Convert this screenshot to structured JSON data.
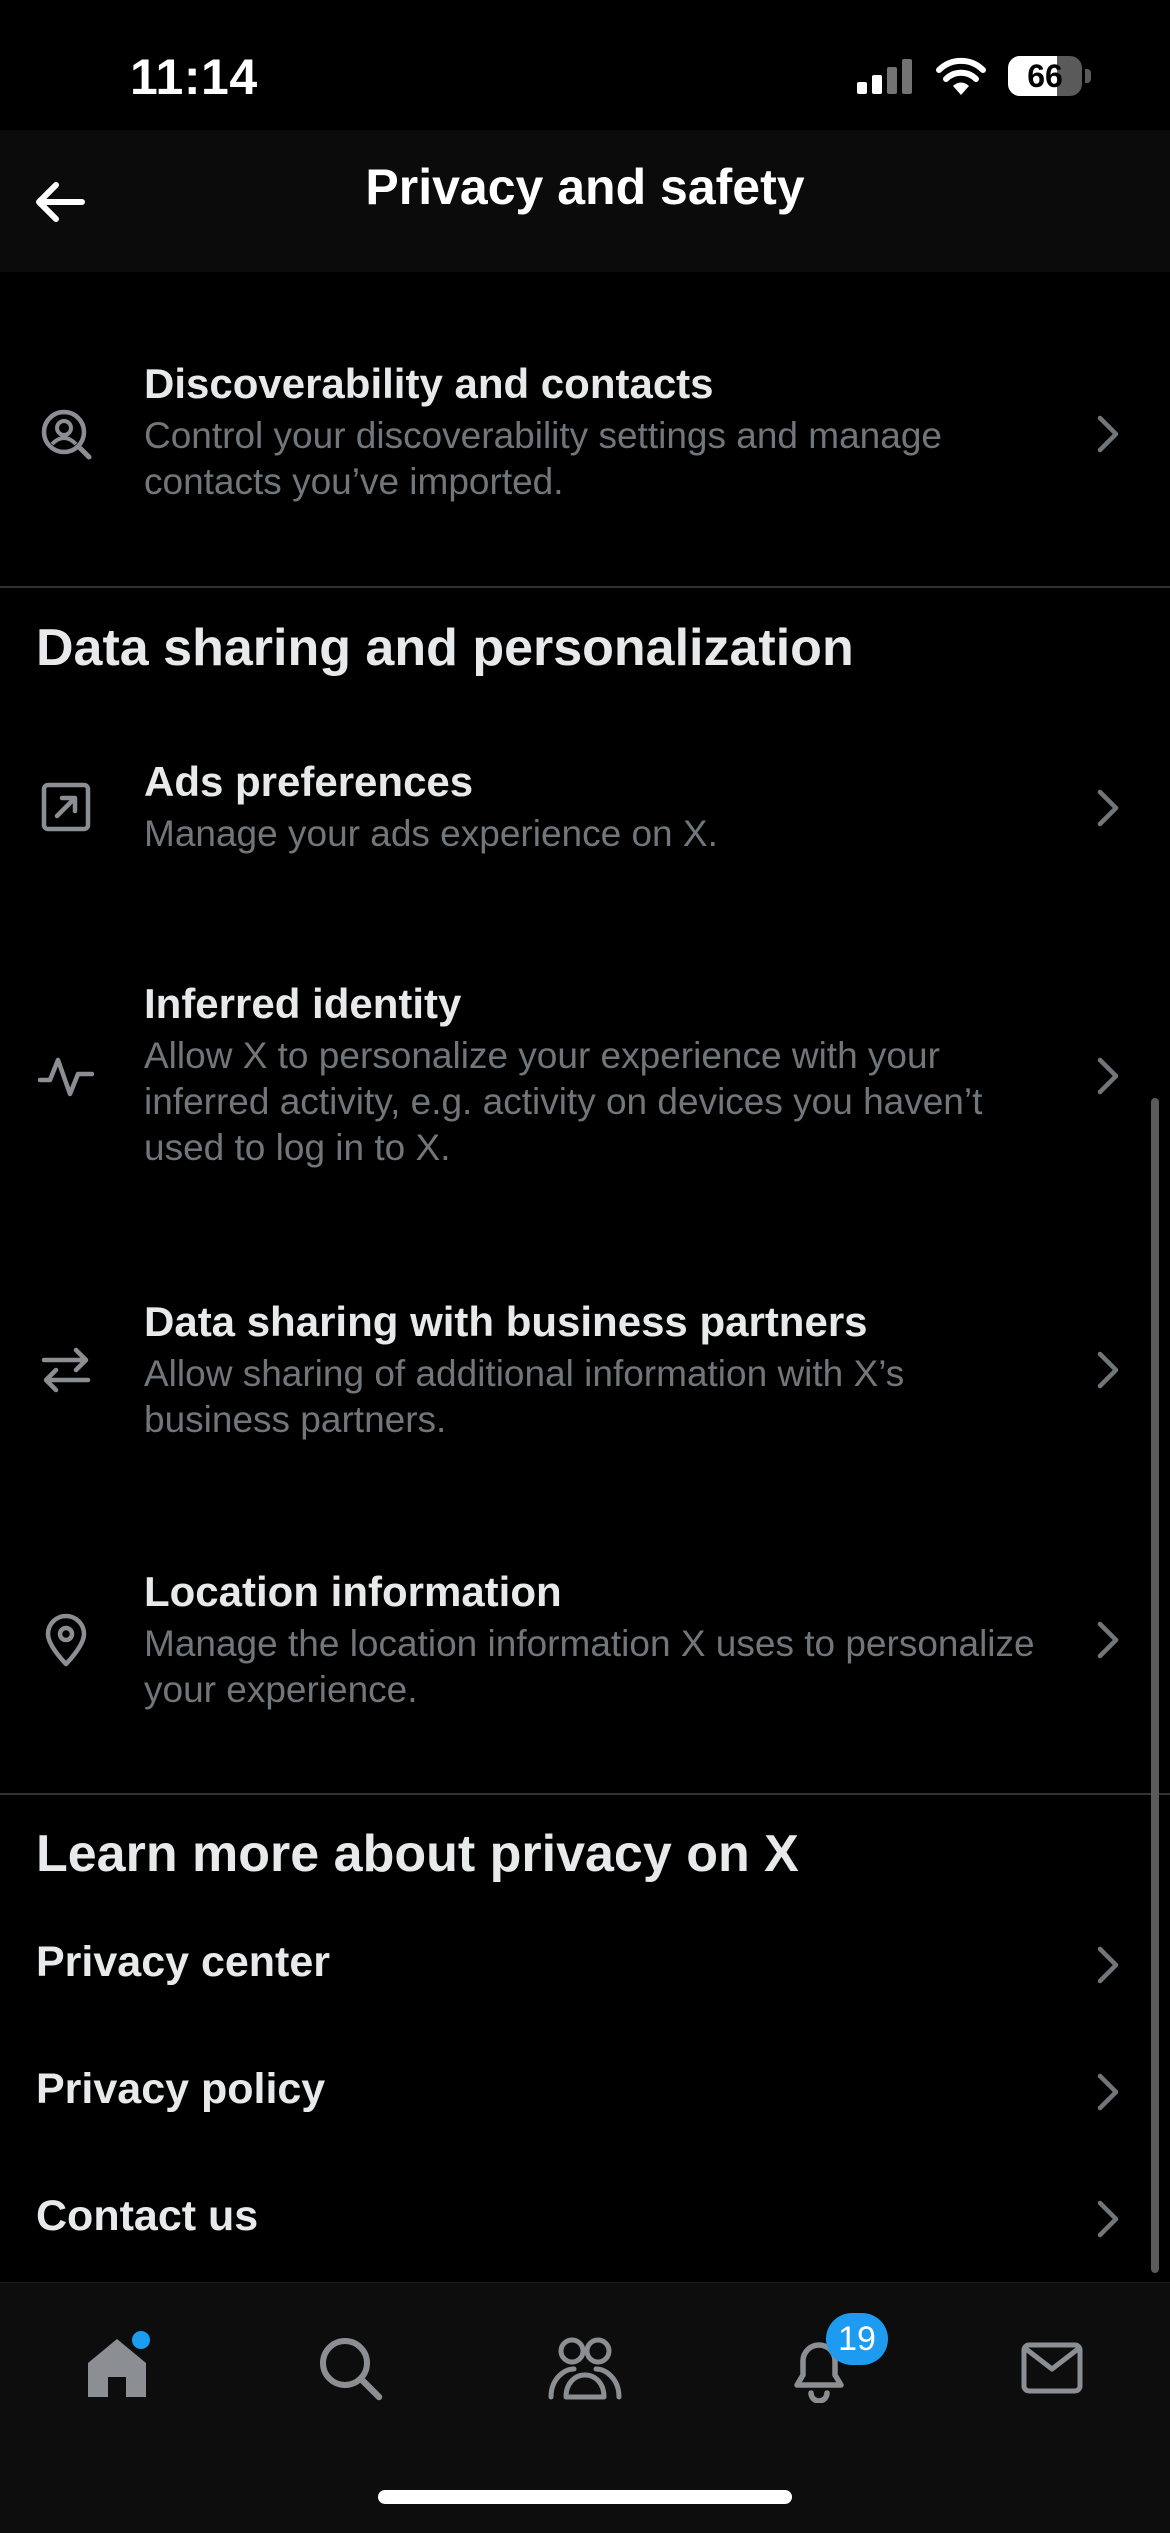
{
  "status_bar": {
    "time": "11:14",
    "battery_level": "66",
    "battery_fraction": 0.66
  },
  "header": {
    "title": "Privacy and safety",
    "back_icon": "arrow-left-icon"
  },
  "rows": {
    "discoverability": {
      "title": "Discoverability and contacts",
      "desc": "Control your discoverability settings and manage contacts you’ve imported.",
      "icon": "person-search-icon"
    },
    "ads": {
      "title": "Ads preferences",
      "desc": "Manage your ads experience on X.",
      "icon": "ad-box-icon"
    },
    "inferred": {
      "title": "Inferred identity",
      "desc": "Allow X to personalize your experience with your inferred activity, e.g. activity on devices you haven’t used to log in to X.",
      "icon": "activity-pulse-icon"
    },
    "data_sharing": {
      "title": "Data sharing with business partners",
      "desc": "Allow sharing of additional information with X’s business partners.",
      "icon": "swap-arrows-icon"
    },
    "location": {
      "title": "Location information",
      "desc": "Manage the location information X uses to personalize your experience.",
      "icon": "location-pin-icon"
    }
  },
  "sections": {
    "data_sharing_heading": "Data sharing and personalization",
    "learn_more_heading": "Learn more about privacy on X"
  },
  "links": {
    "privacy_center": "Privacy center",
    "privacy_policy": "Privacy policy",
    "contact_us": "Contact us"
  },
  "tab_bar": {
    "notifications_badge": "19",
    "tabs": [
      "home-icon",
      "search-icon",
      "communities-icon",
      "notifications-bell-icon",
      "messages-icon"
    ]
  },
  "colors": {
    "background": "#000000",
    "text": "#e7e9ea",
    "secondary_text": "#71767b",
    "accent": "#1d9bf0",
    "divider": "#2f3336"
  }
}
